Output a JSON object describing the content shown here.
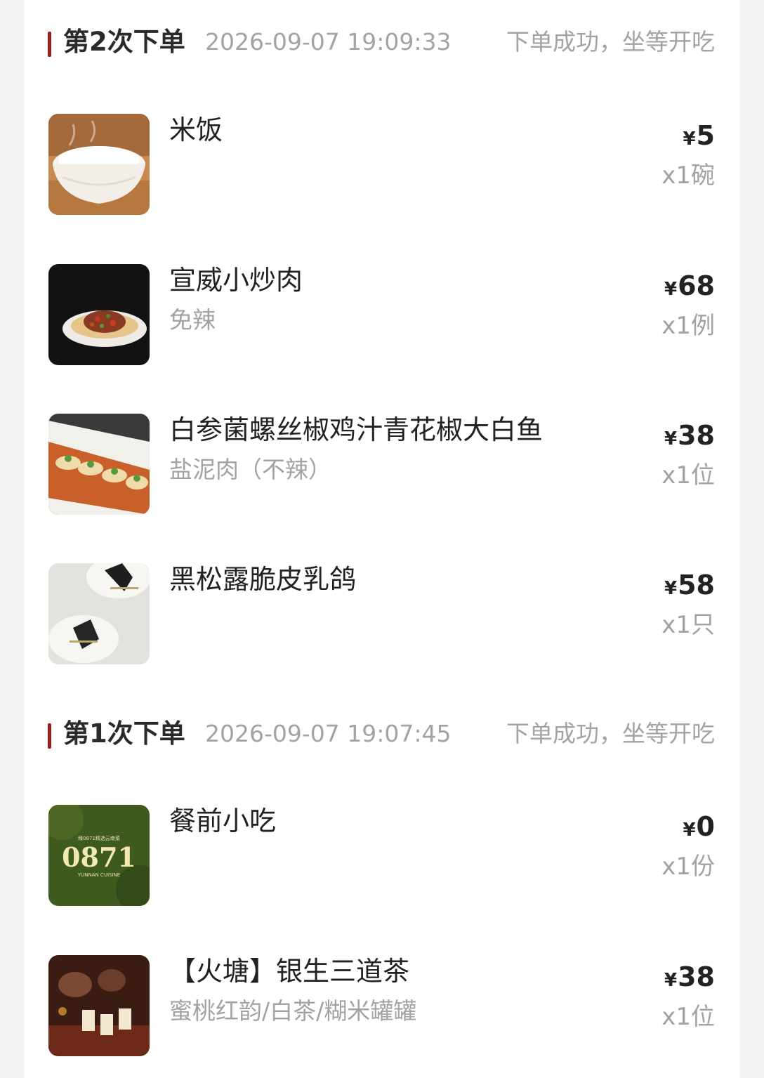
{
  "orders": [
    {
      "title": "第2次下单",
      "time": "2026-09-07 19:09:33",
      "status": "下单成功，坐等开吃",
      "items": [
        {
          "name": "米饭",
          "note": "",
          "currency": "¥",
          "price": "5",
          "qty": "x1碗",
          "thumb_icon": "rice-bowl-image"
        },
        {
          "name": "宣威小炒肉",
          "note": "免辣",
          "currency": "¥",
          "price": "68",
          "qty": "x1例",
          "thumb_icon": "stir-fried-pork-image"
        },
        {
          "name": "白参菌螺丝椒鸡汁青花椒大白鱼",
          "note": "盐泥肉（不辣）",
          "currency": "¥",
          "price": "38",
          "qty": "x1位",
          "thumb_icon": "white-fish-image"
        },
        {
          "name": "黑松露脆皮乳鸽",
          "note": "",
          "currency": "¥",
          "price": "58",
          "qty": "x1只",
          "thumb_icon": "truffle-pigeon-image"
        }
      ]
    },
    {
      "title": "第1次下单",
      "time": "2026-09-07 19:07:45",
      "status": "下单成功，坐等开吃",
      "items": [
        {
          "name": "餐前小吃",
          "note": "",
          "currency": "¥",
          "price": "0",
          "qty": "x1份",
          "thumb_icon": "restaurant-logo-image",
          "logo_text": "0871",
          "logo_top": "臻0871精选云南菜",
          "logo_sub": "YUNNAN CUISINE"
        },
        {
          "name": "【火塘】银生三道茶",
          "note": "蜜桃红韵/白茶/糊米罐罐",
          "currency": "¥",
          "price": "38",
          "qty": "x1位",
          "thumb_icon": "tea-set-image"
        }
      ]
    }
  ],
  "colors": {
    "accent_bar": "#9b1c1c",
    "muted_text": "#a3a3a3",
    "primary_text": "#222222"
  }
}
